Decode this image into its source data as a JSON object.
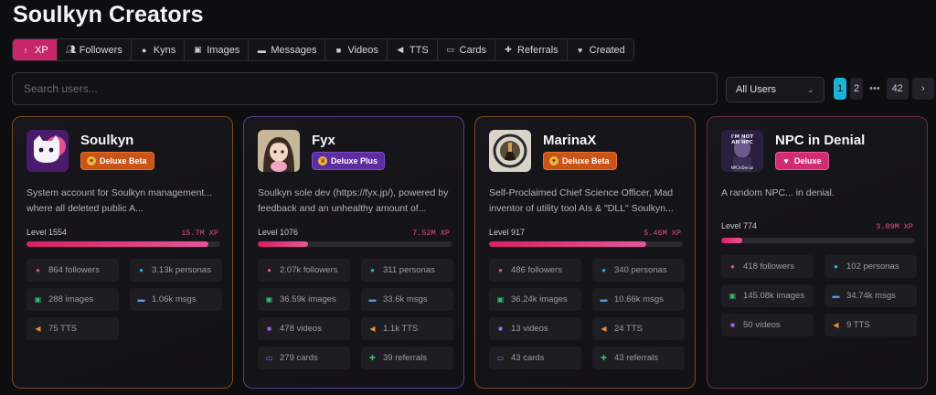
{
  "page": {
    "title": "Soulkyn Creators"
  },
  "tabs": [
    {
      "label": "XP",
      "icon": "arrow-up-icon",
      "active": true
    },
    {
      "label": "Followers",
      "icon": "users-icon"
    },
    {
      "label": "Kyns",
      "icon": "person-icon"
    },
    {
      "label": "Images",
      "icon": "image-icon"
    },
    {
      "label": "Messages",
      "icon": "chat-icon"
    },
    {
      "label": "Videos",
      "icon": "video-icon"
    },
    {
      "label": "TTS",
      "icon": "speaker-icon"
    },
    {
      "label": "Cards",
      "icon": "card-icon"
    },
    {
      "label": "Referrals",
      "icon": "user-plus-icon"
    },
    {
      "label": "Created",
      "icon": "heart-icon"
    }
  ],
  "search": {
    "placeholder": "Search users..."
  },
  "filter": {
    "selected": "All Users"
  },
  "pagination": {
    "pages": [
      "1",
      "2"
    ],
    "current": "1",
    "ellipsis": "•••",
    "last": "42",
    "next_icon": "chevron-right-icon"
  },
  "colors": {
    "accent": "#c8266a",
    "xp_text": "#e0508f",
    "page_active": "#19b4d6"
  },
  "cards": [
    {
      "name": "Soulkyn",
      "badge": "Deluxe Beta",
      "description": "System account for Soulkyn management... where all deleted public A...",
      "level": "Level 1554",
      "xp": "15.7M XP",
      "progress": 0.94,
      "stats": [
        {
          "icon": "users-icon",
          "text": "864 followers"
        },
        {
          "icon": "person-icon",
          "text": "3.13k personas"
        },
        {
          "icon": "image-icon",
          "text": "288 images"
        },
        {
          "icon": "chat-icon",
          "text": "1.06k msgs"
        },
        {
          "icon": "speaker-icon",
          "text": "75 TTS"
        }
      ]
    },
    {
      "name": "Fyx",
      "badge": "Deluxe Plus",
      "description": "Soulkyn sole dev (https://fyx.jp/), powered by feedback and an unhealthy amount of...",
      "level": "Level 1076",
      "xp": "7.52M XP",
      "progress": 0.26,
      "stats": [
        {
          "icon": "users-icon",
          "text": "2.07k followers"
        },
        {
          "icon": "person-icon",
          "text": "311 personas"
        },
        {
          "icon": "image-icon",
          "text": "36.59k images"
        },
        {
          "icon": "chat-icon",
          "text": "33.6k msgs"
        },
        {
          "icon": "video-icon",
          "text": "478 videos"
        },
        {
          "icon": "speaker-icon",
          "text": "1.1k TTS"
        },
        {
          "icon": "card-icon",
          "text": "279 cards"
        },
        {
          "icon": "user-plus-icon",
          "text": "39 referrals"
        }
      ]
    },
    {
      "name": "MarinaX",
      "badge": "Deluxe Beta",
      "description": "Self-Proclaimed Chief Science Officer, Mad inventor of utility tool AIs & \"DLL\" Soulkyn...",
      "level": "Level 917",
      "xp": "5.46M XP",
      "progress": 0.81,
      "stats": [
        {
          "icon": "users-icon",
          "text": "486 followers"
        },
        {
          "icon": "person-icon",
          "text": "340 personas"
        },
        {
          "icon": "image-icon",
          "text": "36.24k images"
        },
        {
          "icon": "chat-icon",
          "text": "10.66k msgs"
        },
        {
          "icon": "video-icon",
          "text": "13 videos"
        },
        {
          "icon": "speaker-icon",
          "text": "24 TTS"
        },
        {
          "icon": "card-icon",
          "text": "43 cards"
        },
        {
          "icon": "user-plus-icon",
          "text": "43 referrals"
        }
      ]
    },
    {
      "name": "NPC in Denial",
      "badge": "Deluxe",
      "description": "A random NPC... in denial.",
      "level": "Level 774",
      "xp": "3.89M XP",
      "progress": 0.11,
      "avatar_text": [
        "I'M NOT",
        "AN NPC",
        "NPCinDenial"
      ],
      "stats": [
        {
          "icon": "users-icon",
          "text": "418 followers"
        },
        {
          "icon": "person-icon",
          "text": "102 personas"
        },
        {
          "icon": "image-icon",
          "text": "145.08k images"
        },
        {
          "icon": "chat-icon",
          "text": "34.74k msgs"
        },
        {
          "icon": "video-icon",
          "text": "50 videos"
        },
        {
          "icon": "speaker-icon",
          "text": "9 TTS"
        }
      ]
    }
  ]
}
